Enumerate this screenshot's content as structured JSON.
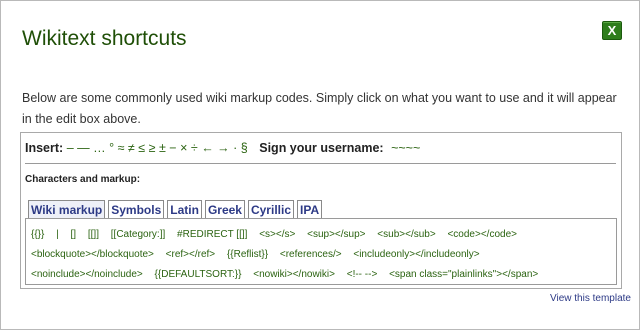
{
  "dialog": {
    "title": "Wikitext shortcuts",
    "close_label": "X",
    "intro": "Below are some commonly used wiki markup codes. Simply click on what you want to use and it will appear in the edit box above."
  },
  "insert": {
    "label": "Insert:",
    "chars": [
      "–",
      "—",
      "…",
      "°",
      "≈",
      "≠",
      "≤",
      "≥",
      "±",
      "−",
      "×",
      "÷",
      "←",
      "→",
      "·",
      "§"
    ],
    "signature_label": "Sign your username:",
    "signature_value": "~~~~"
  },
  "section_label": "Characters and markup:",
  "tabs": [
    "Wiki markup",
    "Symbols",
    "Latin",
    "Greek",
    "Cyrillic",
    "IPA"
  ],
  "codes": [
    "{{}}",
    "|",
    "[]",
    "[[]]",
    "[[Category:]]",
    "#REDIRECT [[]]",
    "<s></s>",
    "<sup></sup>",
    "<sub></sub>",
    "<code></code>",
    "<blockquote></blockquote>",
    "<ref></ref>",
    "{{Reflist}}",
    "<references/>",
    "<includeonly></includeonly>",
    "<noinclude></noinclude>",
    "{{DEFAULTSORT:}}",
    "<nowiki></nowiki>",
    "<!-- -->",
    "<span class=\"plainlinks\"></span>"
  ],
  "footer_link": "View this template"
}
